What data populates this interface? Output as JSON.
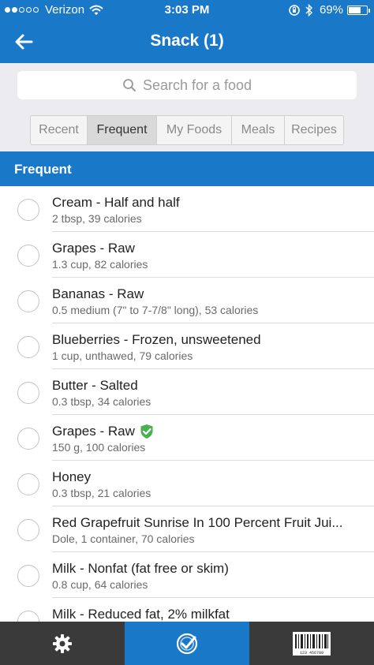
{
  "status_bar": {
    "carrier": "Verizon",
    "time": "3:03 PM",
    "battery": "69%",
    "battery_level": 0.69,
    "signal_bars_filled": 2,
    "signal_bars_total": 5
  },
  "nav": {
    "title": "Snack (1)",
    "back_icon": "arrow-left-icon"
  },
  "search": {
    "placeholder": "Search for a food",
    "icon": "search-icon"
  },
  "tabs": [
    {
      "label": "Recent",
      "active": false
    },
    {
      "label": "Frequent",
      "active": true
    },
    {
      "label": "My Foods",
      "active": false
    },
    {
      "label": "Meals",
      "active": false
    },
    {
      "label": "Recipes",
      "active": false
    }
  ],
  "section": {
    "title": "Frequent"
  },
  "foods": [
    {
      "name": "Cream - Half and half",
      "detail": "2 tbsp, 39 calories",
      "verified": false
    },
    {
      "name": "Grapes - Raw",
      "detail": "1.3 cup, 82 calories",
      "verified": false
    },
    {
      "name": "Bananas - Raw",
      "detail": "0.5 medium (7\" to 7-7/8\" long), 53 calories",
      "verified": false
    },
    {
      "name": "Blueberries - Frozen, unsweetened",
      "detail": "1 cup, unthawed, 79 calories",
      "verified": false
    },
    {
      "name": "Butter - Salted",
      "detail": "0.3 tbsp, 34 calories",
      "verified": false
    },
    {
      "name": "Grapes - Raw",
      "detail": "150 g, 100 calories",
      "verified": true
    },
    {
      "name": "Honey",
      "detail": "0.3 tbsp, 21 calories",
      "verified": false
    },
    {
      "name": "Red Grapefruit Sunrise In 100 Percent Fruit Jui...",
      "detail": "Dole, 1 container, 70 calories",
      "verified": false
    },
    {
      "name": "Milk - Nonfat (fat free or skim)",
      "detail": "0.8 cup, 64 calories",
      "verified": false
    },
    {
      "name": "Milk -  Reduced fat, 2% milkfat",
      "detail": "",
      "verified": false
    }
  ],
  "bottom_bar": {
    "items": [
      {
        "icon": "gear-icon",
        "active": false
      },
      {
        "icon": "checkmark-circle-icon",
        "active": true
      },
      {
        "icon": "barcode-icon",
        "active": false,
        "barcode_text": "123 456789"
      }
    ]
  },
  "colors": {
    "brand_blue": "#1a78c8",
    "verified_green": "#4caf50",
    "bottom_bar": "#3a3a3a"
  }
}
